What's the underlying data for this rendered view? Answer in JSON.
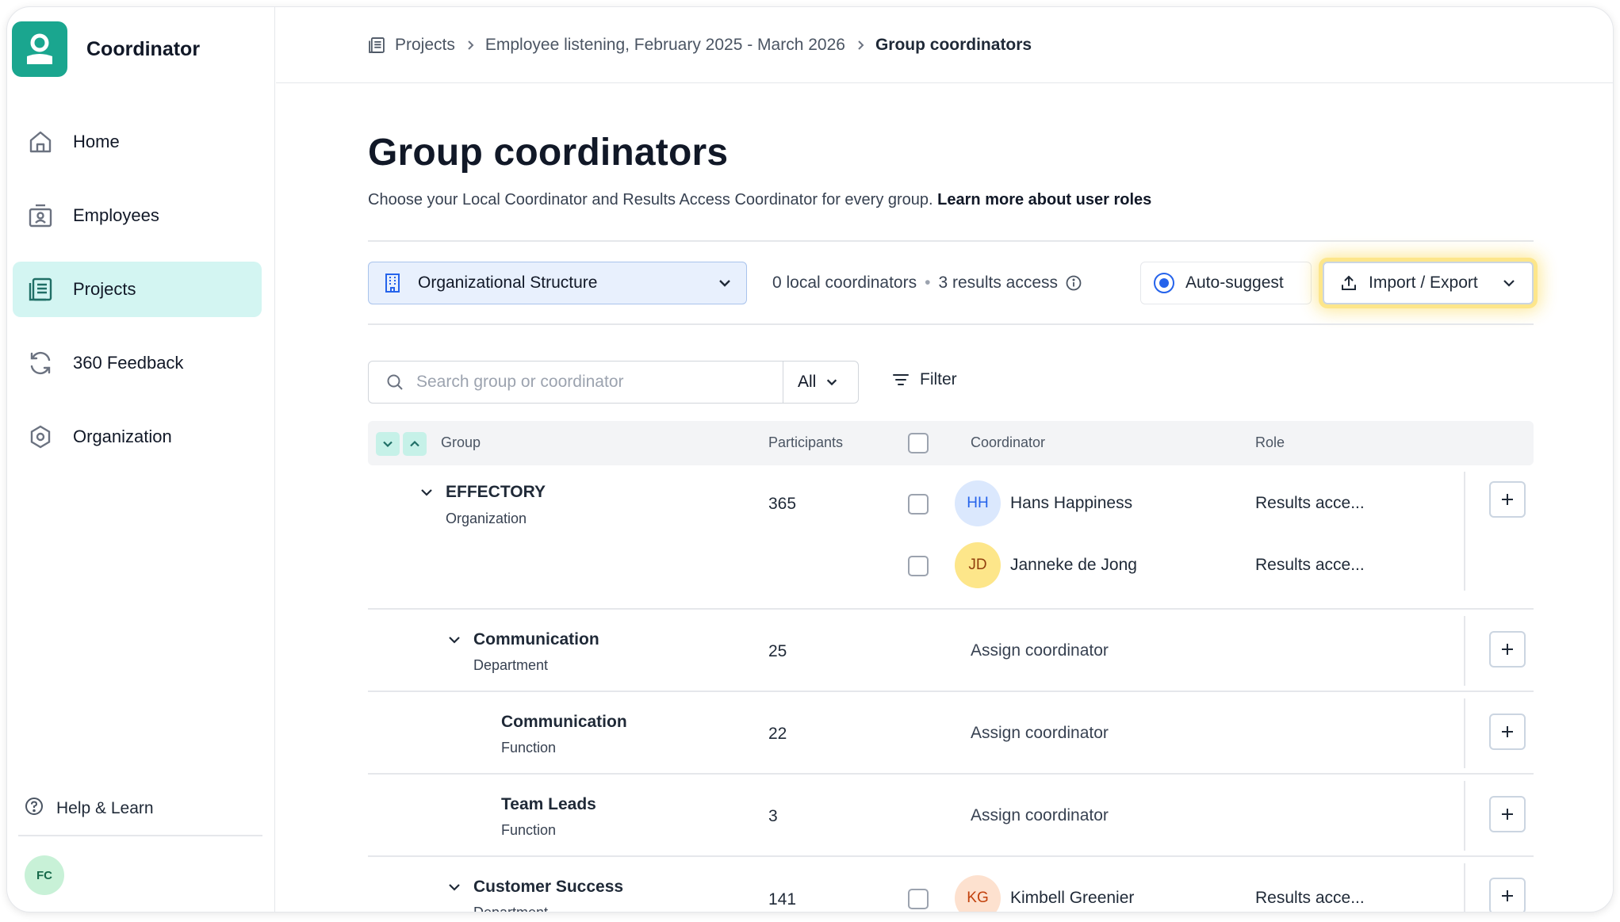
{
  "app": {
    "title": "Coordinator"
  },
  "sidebar": {
    "items": [
      {
        "label": "Home",
        "icon": "home-icon",
        "active": false
      },
      {
        "label": "Employees",
        "icon": "employees-icon",
        "active": false
      },
      {
        "label": "Projects",
        "icon": "projects-icon",
        "active": true
      },
      {
        "label": "360 Feedback",
        "icon": "refresh-icon",
        "active": false
      },
      {
        "label": "Organization",
        "icon": "hexagon-icon",
        "active": false
      }
    ],
    "help_label": "Help & Learn",
    "user_initials": "FC"
  },
  "breadcrumb": {
    "items": [
      "Projects",
      "Employee listening, February 2025 - March 2026",
      "Group coordinators"
    ]
  },
  "page": {
    "title": "Group coordinators",
    "subtitle": "Choose your Local Coordinator and Results Access Coordinator for every group.",
    "learn_more": "Learn more about user roles"
  },
  "toolbar": {
    "structure_label": "Organizational Structure",
    "local_count": "0 local coordinators",
    "results_count": "3 results access",
    "autosuggest_label": "Auto-suggest",
    "import_label": "Import / Export"
  },
  "search": {
    "placeholder": "Search group or coordinator",
    "scope_value": "All",
    "filter_label": "Filter"
  },
  "table": {
    "headers": {
      "group": "Group",
      "participants": "Participants",
      "coordinator": "Coordinator",
      "role": "Role"
    },
    "assign_label": "Assign coordinator",
    "rows": [
      {
        "name": "EFFECTORY",
        "type": "Organization",
        "participants": "365",
        "coordinators": [
          {
            "initials": "HH",
            "name": "Hans Happiness",
            "role": "Results acce...",
            "color": "#dbe8fd",
            "text_color": "#2563eb"
          },
          {
            "initials": "JD",
            "name": "Janneke de Jong",
            "role": "Results acce...",
            "color": "#fde68a",
            "text_color": "#92400e"
          }
        ]
      },
      {
        "name": "Communication",
        "type": "Department",
        "participants": "25"
      },
      {
        "name": "Communication",
        "type": "Function",
        "participants": "22"
      },
      {
        "name": "Team Leads",
        "type": "Function",
        "participants": "3"
      },
      {
        "name": "Customer Success",
        "type": "Department",
        "participants": "141",
        "coordinators": [
          {
            "initials": "KG",
            "name": "Kimbell Greenier",
            "role": "Results acce...",
            "color": "#fde1cf",
            "text_color": "#c2410c"
          }
        ]
      }
    ]
  },
  "colors": {
    "brand": "#1aa68f",
    "active_nav": "#d3f5f2",
    "highlight": "#fde68a"
  }
}
